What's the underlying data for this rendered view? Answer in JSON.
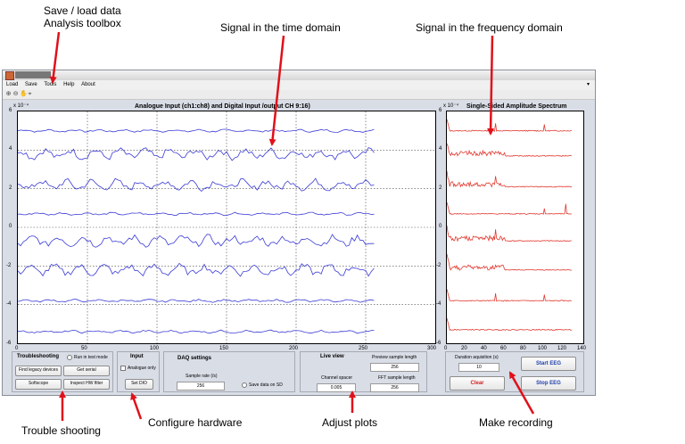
{
  "annotations": {
    "toolbox_line1": "Save / load data",
    "toolbox_line2": "Analysis toolbox",
    "time_domain": "Signal in the time domain",
    "freq_domain": "Signal in the frequency domain",
    "troubleshooting": "Trouble shooting",
    "configure": "Configure hardware",
    "adjust": "Adjust plots",
    "recording": "Make recording"
  },
  "colors": {
    "time_trace": "#3b3bd6",
    "freq_trace": "#e2392f",
    "annotation_arrow": "#e0101a",
    "window_bg": "#d9dde6"
  },
  "window": {
    "menu": [
      "Load",
      "Save",
      "Tools",
      "Help",
      "About"
    ],
    "toolbar_icons": [
      "zoom-in-icon",
      "zoom-out-icon",
      "pan-icon",
      "data-cursor-icon"
    ]
  },
  "time_plot": {
    "title": "Analogue Input (ch1:ch8) and Digital Input /output CH 9:16)",
    "exponent": "x 10⁻⁴",
    "y_ticks": [
      "6",
      "4",
      "2",
      "0",
      "-2",
      "-4",
      "-6"
    ],
    "x_ticks": [
      "0",
      "50",
      "100",
      "150",
      "200",
      "250",
      "300"
    ]
  },
  "freq_plot": {
    "title": "Single-Sided Amplitude Spectrum",
    "exponent": "x 10⁻⁴",
    "y_ticks": [
      "6",
      "4",
      "2",
      "0",
      "-2",
      "-4",
      "-6"
    ],
    "x_ticks": [
      "0",
      "20",
      "40",
      "60",
      "80",
      "100",
      "120",
      "140"
    ]
  },
  "chart_data": [
    {
      "type": "line",
      "title": "Analogue Input (ch1:ch8) and Digital Input /output CH 9:16)",
      "xlim": [
        0,
        300
      ],
      "ylim": [
        -6,
        6
      ],
      "y_scale_label": "x 10⁻⁴",
      "grid": true,
      "channel_offsets": [
        5.0,
        3.8,
        2.2,
        0.7,
        -0.7,
        -2.2,
        -3.8,
        -5.4
      ],
      "x_extent": [
        0,
        256
      ]
    },
    {
      "type": "line",
      "title": "Single-Sided Amplitude Spectrum",
      "xlim": [
        0,
        140
      ],
      "ylim": [
        -6,
        6
      ],
      "y_scale_label": "x 10⁻⁴",
      "grid": false,
      "channel_offsets": [
        5.0,
        3.7,
        2.1,
        0.7,
        -0.7,
        -2.2,
        -3.8,
        -5.3
      ],
      "x_extent": [
        0,
        128
      ]
    }
  ],
  "panels": {
    "troubleshooting": {
      "title": "Troubleshooting",
      "run_test_mode": "Run in test mode",
      "find_legacy": "Find legacy devices",
      "get_serial": "Get serial",
      "softscope": "Softscope",
      "inspect_hw": "Inspect HW filter"
    },
    "input": {
      "title": "Input",
      "analogue_only": "Analogue only",
      "set_dio": "Set DIO"
    },
    "daq": {
      "title": "DAQ settings",
      "sample_rate_label": "Sample rate (/s)",
      "sample_rate_value": "256",
      "save_on_sd": "Save data on SD"
    },
    "live_view": {
      "title": "Live view",
      "preview_label": "Preview sample length",
      "preview_value": "256",
      "channel_spacer_label": "Channel spacer",
      "channel_spacer_value": "0.005",
      "fft_label": "FFT sample length",
      "fft_value": "256"
    },
    "recording": {
      "duration_label": "Duration aquisition (s)",
      "duration_value": "10",
      "start": "Start EEG",
      "clear": "Clear",
      "stop": "Stop EEG"
    }
  }
}
